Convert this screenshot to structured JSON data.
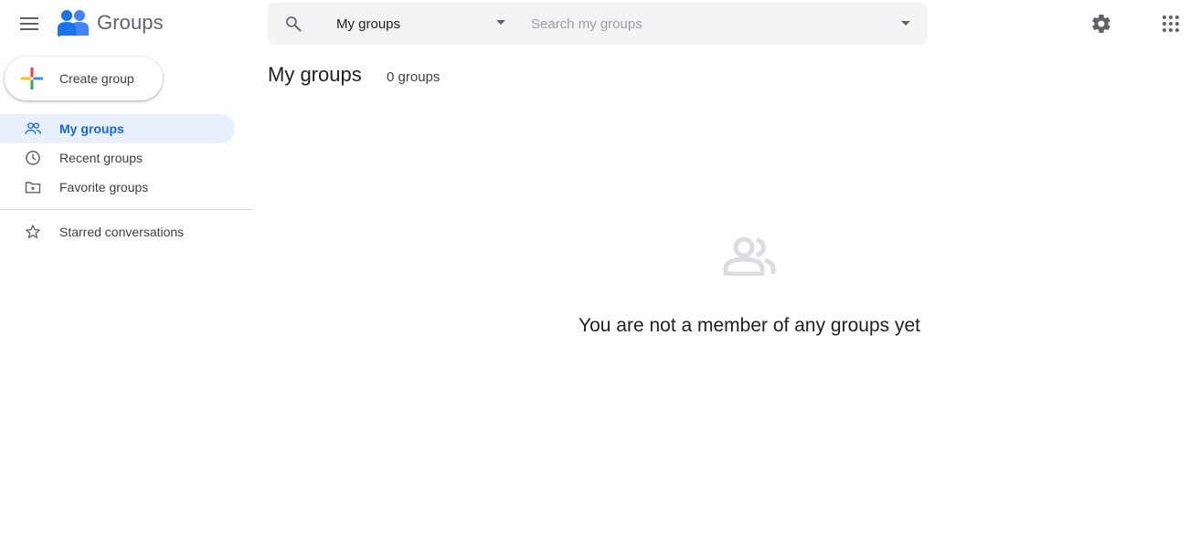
{
  "header": {
    "app_name": "Groups",
    "search": {
      "scope_value": "My groups",
      "placeholder": "Search my groups"
    }
  },
  "sidebar": {
    "create_label": "Create group",
    "items": [
      {
        "label": "My groups",
        "active": true
      },
      {
        "label": "Recent groups",
        "active": false
      },
      {
        "label": "Favorite groups",
        "active": false
      }
    ],
    "starred_label": "Starred conversations"
  },
  "main": {
    "title": "My groups",
    "count": "0 groups",
    "empty_message": "You are not a member of any groups yet"
  },
  "colors": {
    "accent": "#1967d2",
    "active_bg": "#e8f0fe",
    "search_bg": "#f1f3f4",
    "icon_gray": "#5f6368"
  }
}
